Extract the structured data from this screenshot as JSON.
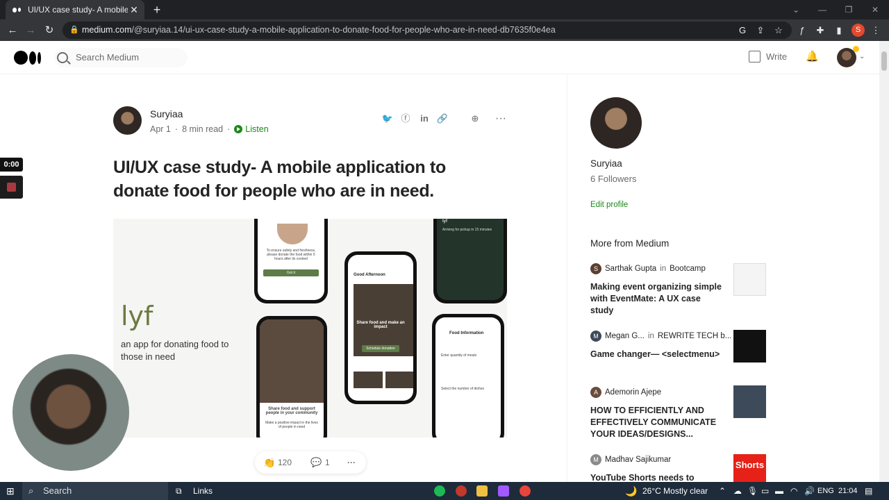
{
  "browser": {
    "tab_title": "UI/UX case study- A mobile appl",
    "tab_close": "✕",
    "new_tab": "+",
    "url_host": "medium.com",
    "url_path": "/@suryiaa.14/ui-ux-case-study-a-mobile-application-to-donate-food-for-people-who-are-in-need-db7635f0e4ea",
    "profile_initial": "S"
  },
  "header": {
    "search_placeholder": "Search Medium",
    "write_label": "Write"
  },
  "article": {
    "author": "Suryiaa",
    "date": "Apr 1",
    "read_time": "8 min read",
    "separator": "·",
    "listen_label": "Listen",
    "title": "UI/UX case study- A mobile application to donate food for people who are in need.",
    "hero": {
      "brand": "lyf",
      "tagline": "an app for donating food to those in need",
      "phone1_text": "To ensure safety and freshness, please donate the food within 5 hours after its cooked",
      "phone1_button": "Got it",
      "phone2_title": "Good Afternoon",
      "phone2_card": "Share food and make an impact",
      "phone2_button": "Schedule donation",
      "phone3_header": "lyf",
      "phone3_text": "Arriving for pickup in 15 minutes",
      "phone4_title": "Food Information",
      "phone4_field1": "Enter quantity of meals",
      "phone4_field2": "Select the number of dishes",
      "phone5_text": "Share food and support people in your community",
      "phone5_sub": "Make a positive impact in the lives of people in need"
    },
    "claps": "120",
    "responses": "1"
  },
  "sidebar": {
    "name": "Suryiaa",
    "followers": "6 Followers",
    "edit_profile": "Edit profile",
    "more_from": "More from Medium",
    "stories": [
      {
        "author": "Sarthak Gupta",
        "in": "in",
        "publication": "Bootcamp",
        "title": "Making event organizing simple with EventMate: A UX case study",
        "initial": "S"
      },
      {
        "author": "Megan G...",
        "in": "in",
        "publication": "REWRITE TECH b...",
        "title": "Game changer— <selectmenu>",
        "initial": "M"
      },
      {
        "author": "Ademorin Ajepe",
        "in": "",
        "publication": "",
        "title": "HOW TO EFFICIENTLY AND EFFECTIVELY COMMUNICATE YOUR IDEAS/DESIGNS...",
        "initial": "A"
      },
      {
        "author": "Madhav Sajikumar",
        "in": "",
        "publication": "",
        "title": "YouTube Shorts needs to",
        "initial": "M"
      }
    ],
    "shorts_thumb_label": "Shorts"
  },
  "recorder": {
    "time": "0:00"
  },
  "taskbar": {
    "search_label": "Search",
    "links_label": "Links",
    "weather": "26°C  Mostly clear",
    "language": "ENG",
    "time": "21:04"
  },
  "colors": {
    "medium_green": "#1a8917",
    "brand_green": "#6c7a3f",
    "chrome_dark": "#202124"
  }
}
